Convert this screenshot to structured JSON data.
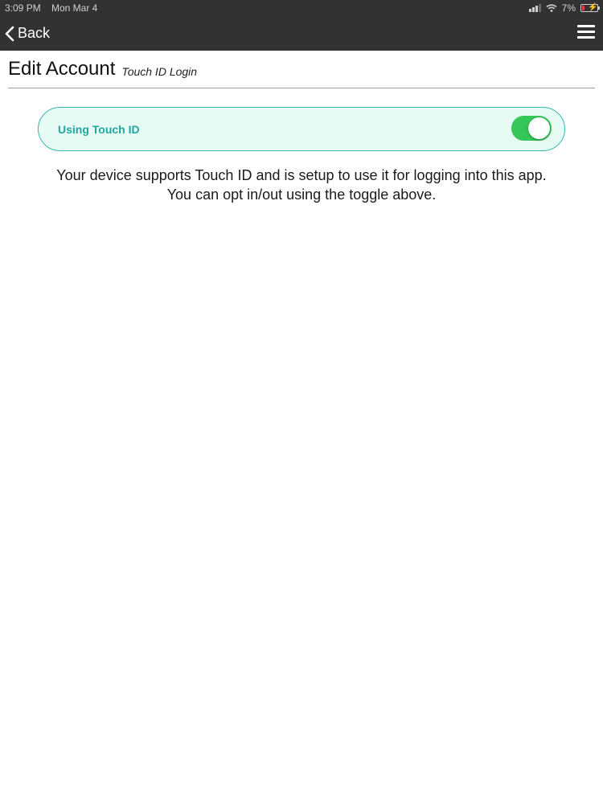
{
  "status_bar": {
    "time": "3:09 PM",
    "date": "Mon Mar 4",
    "battery_percent": "7%",
    "icons": [
      "signal-icon",
      "wifi-icon",
      "battery-icon"
    ]
  },
  "nav": {
    "back_label": "Back",
    "menu_icon": "hamburger-menu-icon"
  },
  "header": {
    "title": "Edit Account",
    "subtitle": "Touch ID Login"
  },
  "touch_id": {
    "label": "Using Touch ID",
    "enabled": true,
    "switch_on_color": "#35c759",
    "card_bg_color": "#e6fbf3",
    "card_border_color": "#39b8ad",
    "label_color": "#20a6a1"
  },
  "info": {
    "line1": "Your device supports Touch ID and is setup to use it for logging into this app.",
    "line2": "You can opt in/out using the toggle above."
  }
}
